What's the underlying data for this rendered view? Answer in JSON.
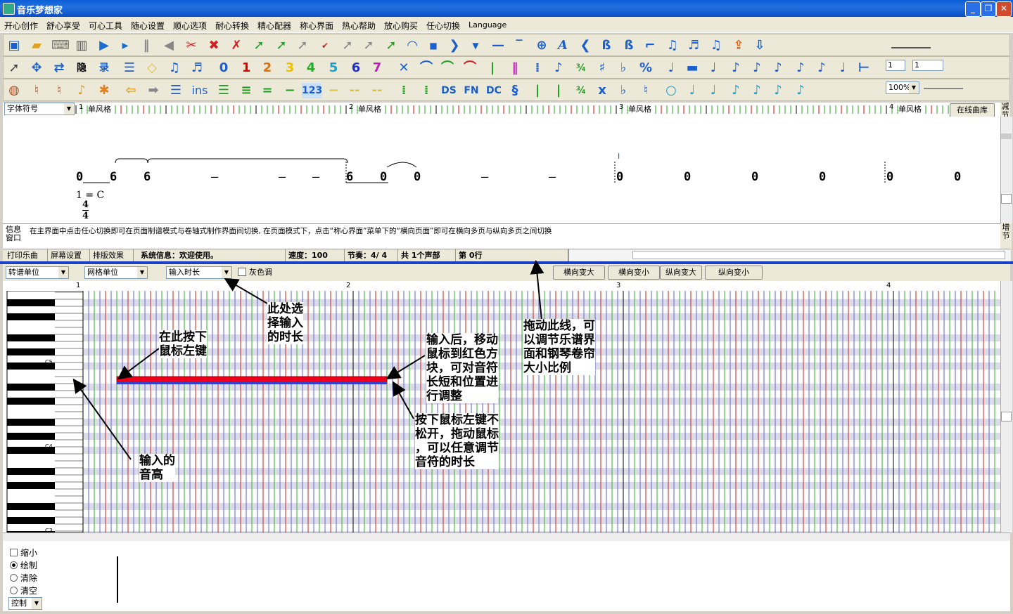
{
  "window": {
    "title": "音乐梦想家"
  },
  "menu": [
    "开心创作",
    "舒心享受",
    "可心工具",
    "随心设置",
    "顺心选项",
    "耐心转换",
    "精心配器",
    "称心界面",
    "热心帮助",
    "放心购买",
    "任心切换",
    "Language"
  ],
  "toolbar": {
    "font_combo": "字体符号",
    "digits": [
      "0",
      "1",
      "2",
      "3",
      "4",
      "5",
      "6",
      "7"
    ],
    "digit_colors": [
      "#1a5fd0",
      "#e00000",
      "#e07000",
      "#f0c000",
      "#20b020",
      "#1aa0d0",
      "#2030c0",
      "#c020c0"
    ],
    "ins_label": "ins",
    "n123_label": "123",
    "ds_label": "DS",
    "fn_label": "FN",
    "dc_label": "DC",
    "x_label": "x",
    "field_a": "1",
    "field_b": "1",
    "zoom_select": "100%"
  },
  "score": {
    "measure_labels": [
      "1",
      "单风格",
      "2",
      "单风格",
      "3",
      "单风格",
      "4",
      "单风格"
    ],
    "online_library_button": "在线曲库",
    "right_tab_top": "减节",
    "right_tab_bottom": "增节",
    "notes": [
      "0",
      "6",
      "6",
      "–",
      "–",
      "–",
      "6",
      "0",
      "0",
      "–",
      "–",
      "0",
      "0",
      "0",
      "0",
      "0",
      "0"
    ],
    "cursor_mark": "I",
    "key_signature": "1 = C",
    "time_sig_top": "4",
    "time_sig_bottom": "4"
  },
  "info": {
    "label_line1": "信息",
    "label_line2": "窗口",
    "text": "在主界面中点击任心切换即可在页面制谱模式与卷轴式制作界面间切换, 在页面模式下，点击“称心界面”菜单下的“横向页面”即可在横向多页与纵向多页之间切换"
  },
  "statusbar": {
    "print_tab": "打印乐曲",
    "screen_tab": "屏幕设置",
    "layout_tab": "排版效果",
    "system_info": "系统信息：欢迎使用。",
    "tempo": "速度：100",
    "beat": "节奏：4/ 4",
    "voices": "共 1个声部",
    "row": "第 0行"
  },
  "pianoroll_toolbar": {
    "transpose_unit": "转谱单位",
    "grid_unit": "网格单位",
    "input_duration": "输入时长",
    "gray_tone_label": "灰色调",
    "h_zoom_in": "横向变大",
    "h_zoom_out": "横向变小",
    "v_zoom_in": "纵向变大",
    "v_zoom_out": "纵向变小"
  },
  "pianoroll": {
    "measure_numbers": [
      "1",
      "2",
      "3",
      "4"
    ],
    "octave_labels": [
      "C5",
      "C4",
      "C3"
    ],
    "note_color": "#e8001c"
  },
  "annotations": {
    "select_duration": "此处选\n择输入\n的时长",
    "press_left": "在此按下\n鼠标左键",
    "adjust_after": "输入后，移动\n鼠标到红色方\n块，可对音符\n长短和位置进\n行调整",
    "drag_line": "拖动此线，可\n以调节乐谱界\n面和钢琴卷帘\n大小比例",
    "drag_duration": "按下鼠标左键不\n松开，拖动鼠标\n，可以任意调节\n音符的时长",
    "input_pitch": "输入的\n音高"
  },
  "bottom": {
    "shrink": "缩小",
    "draw": "绘制",
    "clear": "清除",
    "empty": "清空",
    "control_select": "控制"
  }
}
